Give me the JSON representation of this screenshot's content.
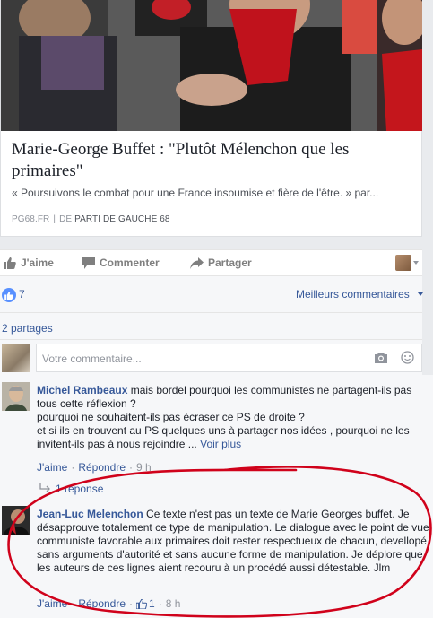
{
  "link_card": {
    "title": "Marie-George Buffet : \"Plutôt Mélenchon que les primaires\"",
    "description": "« Poursuivons le combat pour une France insoumise et fière de l'être. » par...",
    "domain": "PG68.FR",
    "separator": "|",
    "by_label": "DE",
    "site_name": "PARTI DE GAUCHE 68",
    "image_icon": "protest-photo"
  },
  "actions": {
    "like": "J'aime",
    "comment": "Commenter",
    "share": "Partager"
  },
  "stats": {
    "like_count": "7",
    "sort_label": "Meilleurs commentaires",
    "shares": "2 partages"
  },
  "composer": {
    "placeholder": "Votre commentaire..."
  },
  "comments": [
    {
      "author": "Michel Rambeaux",
      "text_line1": " mais bordel pourquoi les communistes ne partagent-ils pas tous cette réflexion ?",
      "text_line2": "pourquoi ne souhaitent-ils pas écraser ce PS de droite ?",
      "text_line3": "et si ils en trouvent au PS quelques uns à partager nos idées , pourquoi ne les invitent-ils pas à nous rejoindre ...",
      "see_more": "Voir plus",
      "like_label": "J'aime",
      "reply_label": "Répondre",
      "time": "9 h",
      "replies": "1 réponse"
    },
    {
      "author": "Jean-Luc Melenchon",
      "text": " Ce texte n'est pas un texte de Marie Georges buffet. Je désapprouve totalement ce type de manipulation. Le dialogue avec le point de vue communiste favorable aux primaires doit rester respectueux de chacun, devellopé sans arguments d'autorité et sans aucune forme de manipulation. Je déplore que les auteurs de ces lignes aient recouru à un procédé aussi détestable. Jlm",
      "like_label": "J'aime",
      "reply_label": "Répondre",
      "like_count": "1",
      "time": "8 h"
    }
  ],
  "colors": {
    "link_blue": "#365899",
    "annotation_red": "#d0021b",
    "like_badge": "#5890ff"
  }
}
